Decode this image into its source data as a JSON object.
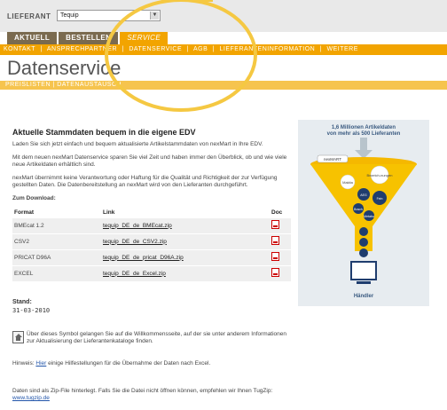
{
  "header": {
    "lieferant_label": "LIEFERANT",
    "lieferant_value": "Tequip"
  },
  "tabs": [
    {
      "label": "AKTUELL",
      "active": false
    },
    {
      "label": "BESTELLEN",
      "active": false
    },
    {
      "label": "SERVICE",
      "active": true
    }
  ],
  "subnav": [
    "KONTAKT",
    "|",
    "ANSPRECHPARTNER",
    "|",
    "DATENSERVICE",
    "|",
    "AGB",
    "|",
    "LIEFERANTENINFORMATION",
    "|",
    "WEITERE"
  ],
  "page_title": "Datenservice",
  "crumbs": "PREISLISTEN | DATENAUSTAUSCH",
  "main": {
    "heading": "Aktuelle Stammdaten bequem in die eigene EDV",
    "p1": "Laden Sie sich jetzt einfach und bequem aktualisierte Artikelstammdaten von nexMart in Ihre EDV.",
    "p2": "Mit dem neuen nexMart Datenservice sparen Sie viel Zeit und haben immer den Überblick, ob und wie viele neue Artikeldaten erhältlich sind.",
    "p3": "nexMart übernimmt keine Verantwortung oder Haftung für die Qualität und Richtigkeit der zur Verfügung gestellten Daten. Die Datenbereitstellung an nexMart wird von den Lieferanten durchgeführt.",
    "download_heading": "Zum Download:",
    "table": {
      "headers": {
        "format": "Format",
        "link": "Link",
        "doc": "Doc"
      },
      "rows": [
        {
          "format": "BMEcat 1.2",
          "link": "tequip_DE_de_BMEcat.zip"
        },
        {
          "format": "CSV2",
          "link": "tequip_DE_de_CSV2.zip"
        },
        {
          "format": "PRICAT D96A",
          "link": "tequip_DE_de_pricat_D96A.zip"
        },
        {
          "format": "EXCEL",
          "link": "tequip_DE_de_Excel.zip"
        }
      ]
    },
    "stand_label": "Stand:",
    "stand_date": "31-03-2010",
    "info_text": "Über dieses Symbol gelangen Sie auf die Willkommensseite, auf der sie unter anderem Informationen zur Aktualisierung der Lieferantenkataloge finden.",
    "hinweis_prefix": "Hinweis: ",
    "hinweis_link": "Hier",
    "hinweis_suffix": " einige Hilfestellungen für die Übernahme der Daten nach Excel.",
    "zip_text": "Daten sind als Zip-File hinterlegt. Falls Sie die Datei nicht öffnen können, empfehlen wir Ihnen TugZip: ",
    "zip_link": "www.tugzip.de"
  },
  "graphic": {
    "title_line1": "1,6 Millionen Artikeldaten",
    "title_line2": "von mehr als 500 Lieferanten",
    "funnel_logo": "nexMART",
    "bubbles": [
      "Makita",
      "Bosch",
      "Bosch",
      "Festool",
      "Metabo"
    ],
    "bubble_labels": [
      "Makita",
      "Bezeich-nungen",
      "AEG",
      "Fein",
      "Bosch",
      "Metabo"
    ],
    "footer": "Händler"
  },
  "colors": {
    "accent": "#f2a400",
    "tab_dark": "#7a6a4f",
    "overlay_circle": "#f5c842"
  }
}
